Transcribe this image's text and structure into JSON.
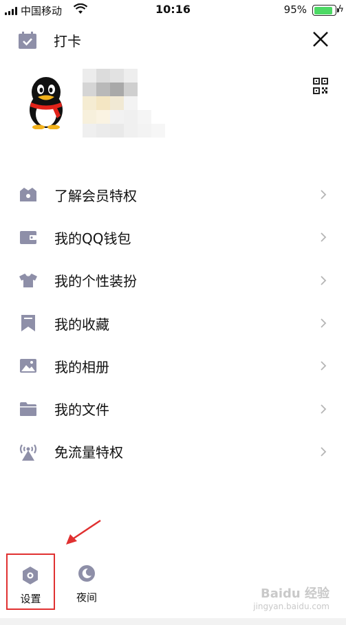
{
  "status_bar": {
    "carrier": "中国移动",
    "time": "10:16",
    "battery_percent": "95%",
    "battery_level": 0.95
  },
  "header": {
    "checkin_label": "打卡"
  },
  "menu": {
    "items": [
      {
        "label": "了解会员特权",
        "icon": "crown-icon"
      },
      {
        "label": "我的QQ钱包",
        "icon": "wallet-icon"
      },
      {
        "label": "我的个性装扮",
        "icon": "shirt-icon"
      },
      {
        "label": "我的收藏",
        "icon": "bookmark-icon"
      },
      {
        "label": "我的相册",
        "icon": "photo-icon"
      },
      {
        "label": "我的文件",
        "icon": "folder-icon"
      },
      {
        "label": "免流量特权",
        "icon": "signal-tower-icon"
      }
    ]
  },
  "bottom": {
    "settings_label": "设置",
    "night_label": "夜间"
  },
  "watermark": {
    "brand": "Baidu 经验",
    "domain": "jingyan.baidu.com"
  },
  "colors": {
    "icon_gray": "#8e8fa8",
    "highlight_red": "#e03030",
    "battery_green": "#4cd964"
  }
}
